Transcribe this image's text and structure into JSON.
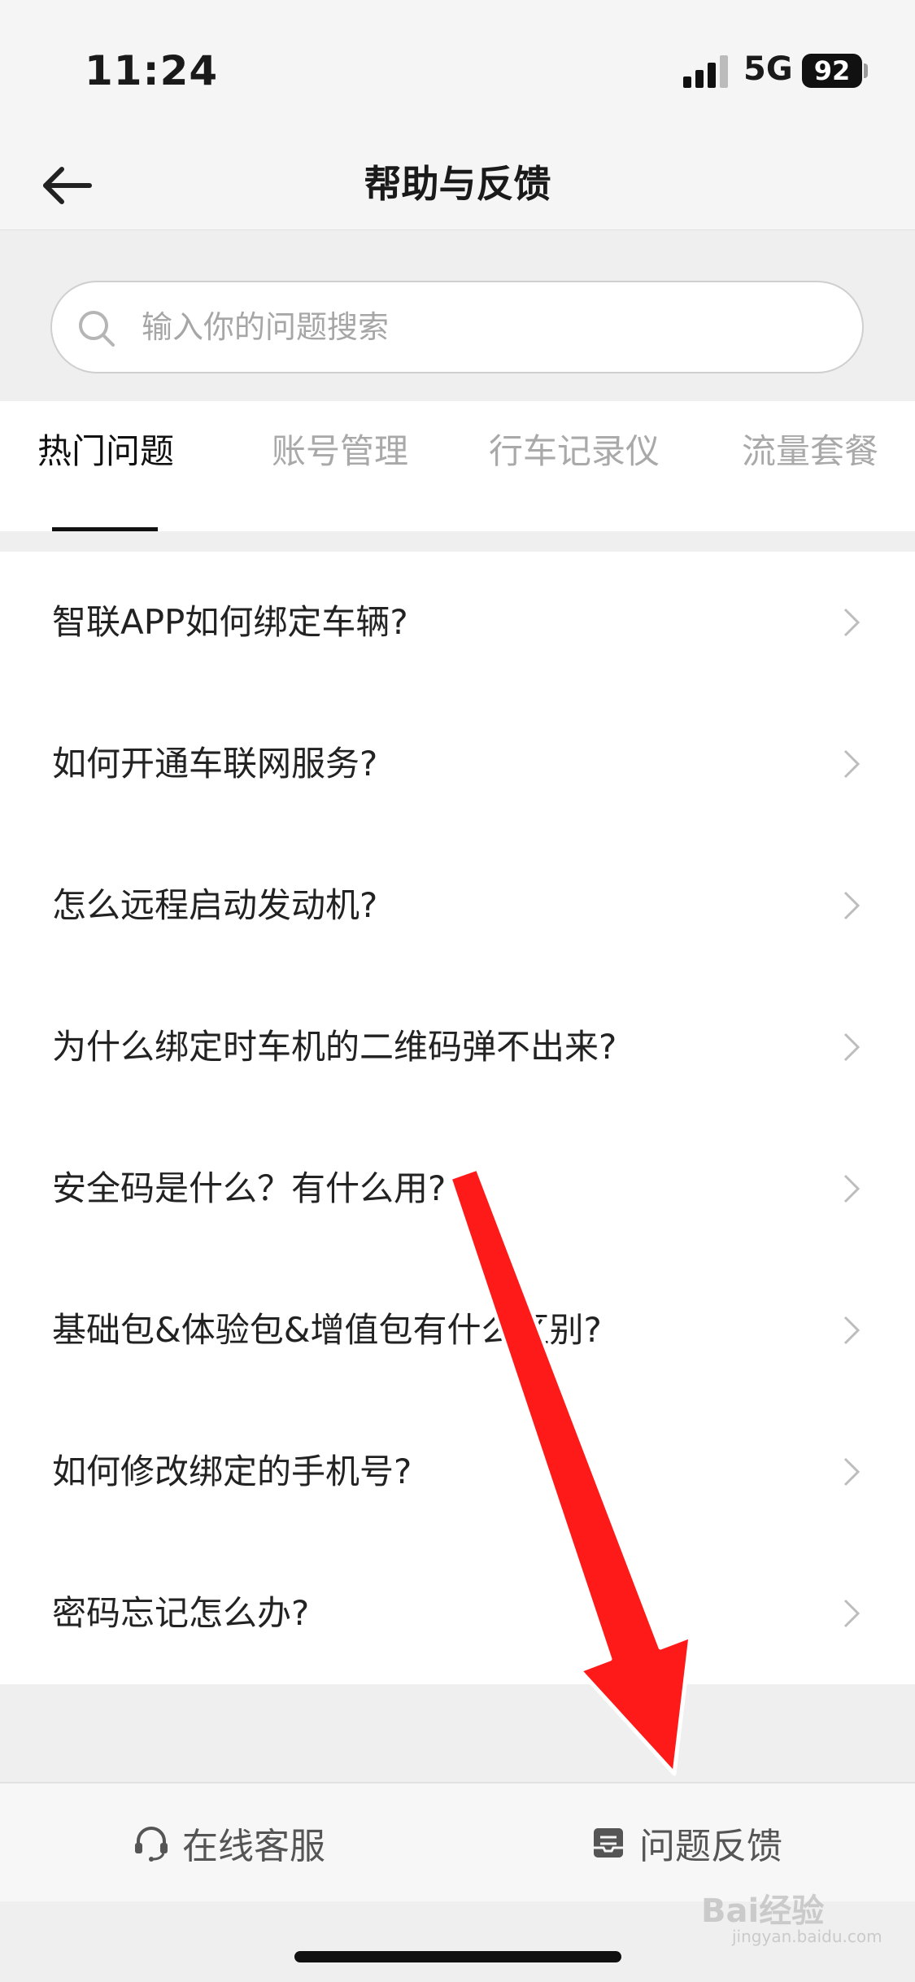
{
  "status_bar": {
    "time": "11:24",
    "network": "5G",
    "battery": "92"
  },
  "nav": {
    "title": "帮助与反馈",
    "back_icon": "arrow-left-icon"
  },
  "search": {
    "placeholder": "输入你的问题搜索",
    "value": ""
  },
  "tabs": [
    {
      "label": "热门问题",
      "active": true
    },
    {
      "label": "账号管理",
      "active": false
    },
    {
      "label": "行车记录仪",
      "active": false
    },
    {
      "label": "流量套餐",
      "active": false
    }
  ],
  "questions": [
    "智联APP如何绑定车辆?",
    "如何开通车联网服务?",
    "怎么远程启动发动机?",
    "为什么绑定时车机的二维码弹不出来?",
    "安全码是什么？有什么用?",
    "基础包&体验包&增值包有什么区别?",
    "如何修改绑定的手机号?",
    "密码忘记怎么办?"
  ],
  "bottom_bar": {
    "online_service": "在线客服",
    "feedback": "问题反馈"
  },
  "annotation": {
    "color": "#ff0000",
    "icon": "red-arrow-annotation"
  },
  "watermark": {
    "text": "Bai经验",
    "sub": "jingyan.baidu.com"
  }
}
